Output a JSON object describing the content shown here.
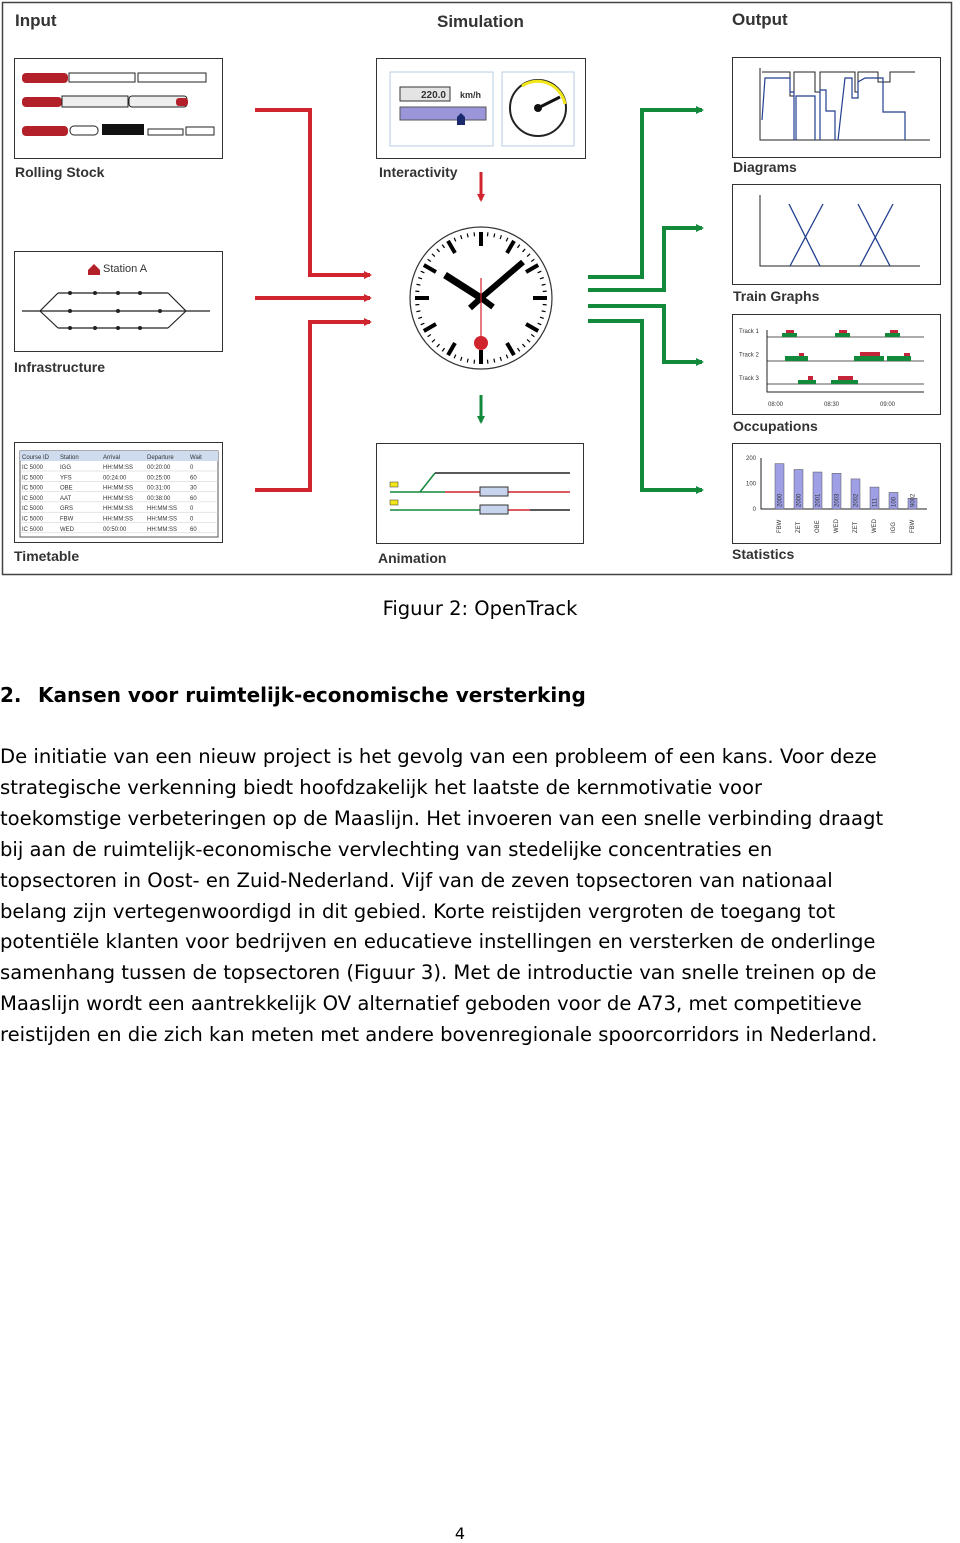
{
  "figure": {
    "sections": {
      "input": "Input",
      "simulation": "Simulation",
      "output": "Output"
    },
    "panels": {
      "rolling_stock": "Rolling Stock",
      "infrastructure": "Infrastructure",
      "timetable": "Timetable",
      "interactivity": "Interactivity",
      "animation": "Animation",
      "diagrams": "Diagrams",
      "train_graphs": "Train Graphs",
      "occupations": "Occupations",
      "statistics": "Statistics"
    },
    "station_label": "Station A",
    "speed_value": "220.0",
    "speed_unit": "km/h",
    "timetable_headers": [
      "Course ID",
      "Station",
      "Arrival",
      "Departure",
      "Wait"
    ],
    "timetable_rows": [
      [
        "IC 5000",
        "IGG",
        "HH:MM:SS",
        "00:20:00",
        "0"
      ],
      [
        "IC 5000",
        "YFS",
        "00:24:00",
        "00:25:00",
        "60"
      ],
      [
        "IC 5000",
        "OBE",
        "HH:MM:SS",
        "00:31:00",
        "30"
      ],
      [
        "IC 5000",
        "AAT",
        "HH:MM:SS",
        "00:38:00",
        "60"
      ],
      [
        "IC 5000",
        "GRS",
        "HH:MM:SS",
        "HH:MM:SS",
        "0"
      ],
      [
        "IC 5000",
        "FBW",
        "HH:MM:SS",
        "HH:MM:SS",
        "0"
      ],
      [
        "IC 5000",
        "WED",
        "00:50:00",
        "HH:MM:SS",
        "60"
      ]
    ],
    "occupation_tracks": [
      "Track 1",
      "Track 2",
      "Track 3"
    ],
    "occupation_times": [
      "08:00",
      "08:30",
      "09:00"
    ],
    "statistics_bars": [
      {
        "station": "FBW",
        "train": "2000",
        "value": 178
      },
      {
        "station": "ZET",
        "train": "2000",
        "value": 155
      },
      {
        "station": "OBE",
        "train": "2001",
        "value": 145
      },
      {
        "station": "WED",
        "train": "2003",
        "value": 140
      },
      {
        "station": "ZET",
        "train": "2002",
        "value": 118
      },
      {
        "station": "WED",
        "train": "111",
        "value": 86
      },
      {
        "station": "IGG",
        "train": "100",
        "value": 65
      },
      {
        "station": "FBW",
        "train": "9002",
        "value": 42
      }
    ],
    "colors": {
      "input_arrows": "#d0252f",
      "output_arrows": "#13893c",
      "bars": "#9f9fe6"
    }
  },
  "caption": "Figuur 2: OpenTrack",
  "section": {
    "number": "2.",
    "title": "Kansen voor ruimtelijk-economische versterking"
  },
  "paragraph_lines": [
    "De initiatie van een nieuw project is het gevolg van een probleem of een kans. Voor deze",
    "strategische verkenning biedt hoofdzakelijk het laatste de kernmotivatie voor",
    "toekomstige verbeteringen op de Maaslijn. Het invoeren van een snelle verbinding draagt",
    "bij aan de ruimtelijk-economische vervlechting van stedelijke concentraties en",
    "topsectoren in Oost- en Zuid-Nederland. Vijf van de zeven topsectoren van nationaal",
    "belang zijn vertegenwoordigd in dit gebied. Korte reistijden vergroten de toegang tot",
    "potentiële klanten voor bedrijven en educatieve instellingen en versterken de onderlinge",
    "samenhang tussen de topsectoren (Figuur 3). Met de introductie van snelle treinen op de",
    "Maaslijn wordt een aantrekkelijk OV alternatief geboden voor de A73, met competitieve",
    "reistijden en die zich kan meten met andere bovenregionale spoorcorridors in Nederland."
  ],
  "page_number": "4"
}
